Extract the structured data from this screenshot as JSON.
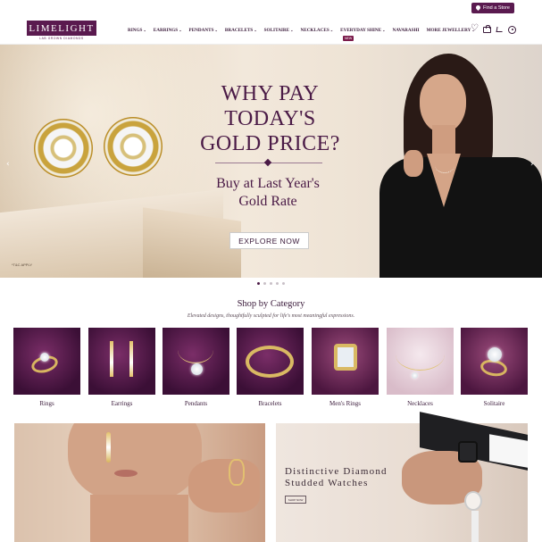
{
  "topbar": {
    "find_store": "Find a Store"
  },
  "brand": {
    "name": "LIMELIGHT",
    "tagline": "LAB GROWN DIAMONDS"
  },
  "nav": {
    "items": [
      "RINGS",
      "EARRINGS",
      "PENDANTS",
      "BRACELETS",
      "SOLITAIRE",
      "NECKLACES",
      "EVERYDAY SHINE",
      "NAVARASHI",
      "MORE JEWELLERY"
    ],
    "new_badge": "NEW"
  },
  "hero": {
    "headline_l1": "WHY PAY",
    "headline_l2": "TODAY'S",
    "headline_l3": "GOLD PRICE?",
    "sub_l1": "Buy at Last Year's",
    "sub_l2": "Gold Rate",
    "cta": "EXPLORE NOW",
    "tc": "*T&C APPLY",
    "slides": 5,
    "active_slide": 1
  },
  "categories": {
    "title": "Shop by Category",
    "subtitle": "Elevated designs, thoughtfully sculpted for life's most meaningful expressions.",
    "items": [
      "Rings",
      "Earrings",
      "Pendants",
      "Bracelets",
      "Men's Rings",
      "Necklaces",
      "Solitaire"
    ]
  },
  "promo": {
    "right_title_l1": "Distinctive Diamond",
    "right_title_l2": "Studded Watches",
    "right_cta": "SHOP NOW"
  },
  "colors": {
    "brand": "#5a1a4f",
    "headline": "#4a1a46"
  }
}
